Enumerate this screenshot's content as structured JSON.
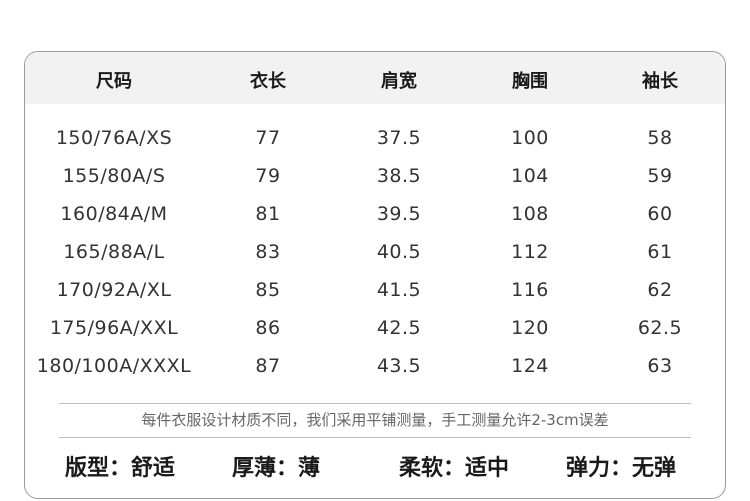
{
  "table": {
    "headers": [
      "尺码",
      "衣长",
      "肩宽",
      "胸围",
      "袖长"
    ],
    "rows": [
      [
        "150/76A/XS",
        "77",
        "37.5",
        "100",
        "58"
      ],
      [
        "155/80A/S",
        "79",
        "38.5",
        "104",
        "59"
      ],
      [
        "160/84A/M",
        "81",
        "39.5",
        "108",
        "60"
      ],
      [
        "165/88A/L",
        "83",
        "40.5",
        "112",
        "61"
      ],
      [
        "170/92A/XL",
        "85",
        "41.5",
        "116",
        "62"
      ],
      [
        "175/96A/XXL",
        "86",
        "42.5",
        "120",
        "62.5"
      ],
      [
        "180/100A/XXXL",
        "87",
        "43.5",
        "124",
        "63"
      ]
    ]
  },
  "note": "每件衣服设计材质不同，我们采用平铺测量，手工测量允许2-3cm误差",
  "attributes": [
    "版型：舒适",
    "厚薄：薄",
    "柔软：适中",
    "弹力：无弹"
  ]
}
